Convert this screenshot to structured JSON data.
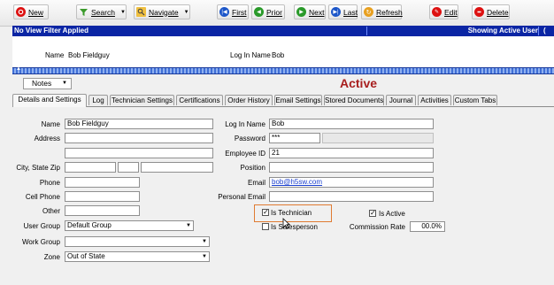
{
  "toolbar": {
    "new": "New",
    "search": "Search",
    "navigate": "Navigate",
    "first": "First",
    "prior": "Prior",
    "next": "Next",
    "last": "Last",
    "refresh": "Refresh",
    "edit": "Edit",
    "delete": "Delete"
  },
  "status": {
    "filter": "No View Filter Applied",
    "showing": "Showing Active User",
    "edge": "("
  },
  "header": {
    "name_label": "Name",
    "name_value": "Bob Fieldguy",
    "login_label": "Log In Name",
    "login_value": "Bob"
  },
  "notes_label": "Notes",
  "active_label": "Active",
  "tabs": [
    "Details and Settings",
    "Log",
    "Technician Settings",
    "Certifications",
    "Order History",
    "Email Settings",
    "Stored Documents",
    "Journal",
    "Activities",
    "Custom Tabs"
  ],
  "form": {
    "name_label": "Name",
    "name_value": "Bob Fieldguy",
    "address_label": "Address",
    "city_label": "City, State Zip",
    "phone_label": "Phone",
    "cell_label": "Cell Phone",
    "other_label": "Other",
    "usergroup_label": "User Group",
    "usergroup_value": "Default Group",
    "workgroup_label": "Work Group",
    "workgroup_value": "",
    "zone_label": "Zone",
    "zone_value": "Out of State",
    "login_label": "Log In Name",
    "login_value": "Bob",
    "password_label": "Password",
    "password_value": "***",
    "employee_label": "Employee ID",
    "employee_value": "21",
    "position_label": "Position",
    "email_label": "Email",
    "email_value": "bob@h5sw.com",
    "personal_email_label": "Personal Email",
    "is_technician_label": "Is Technician",
    "is_salesperson_label": "Is Salesperson",
    "is_active_label": "Is Active",
    "commission_label": "Commission Rate",
    "commission_value": "00.0%"
  },
  "colors": {
    "accent_blue": "#0a25a4",
    "active_red": "#a81e1e",
    "highlight": "#e07b32"
  }
}
